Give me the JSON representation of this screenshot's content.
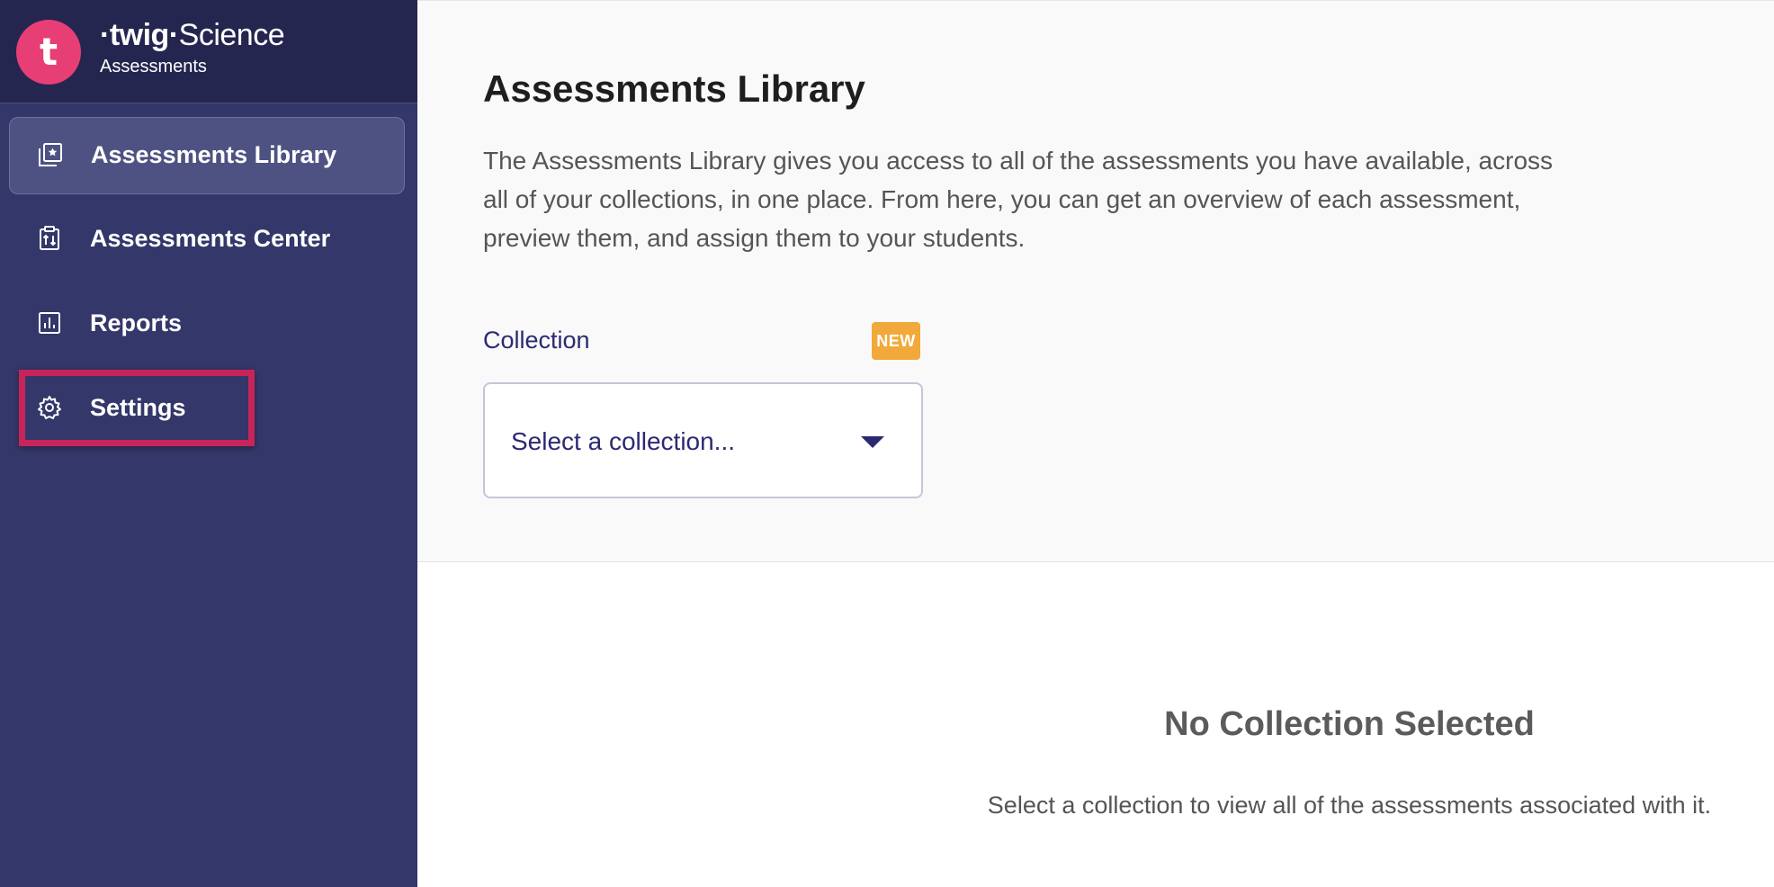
{
  "brand": {
    "logo_letter": "t",
    "wordmark_bold": "·twig·",
    "wordmark_light": "Science",
    "subtitle": "Assessments"
  },
  "sidebar": {
    "items": [
      {
        "label": "Assessments Library",
        "icon": "library-star-icon",
        "active": true
      },
      {
        "label": "Assessments Center",
        "icon": "clipboard-sort-icon",
        "active": false
      },
      {
        "label": "Reports",
        "icon": "bar-chart-icon",
        "active": false
      },
      {
        "label": "Settings",
        "icon": "gear-icon",
        "active": false,
        "highlighted": true
      }
    ]
  },
  "main": {
    "title": "Assessments Library",
    "description": "The Assessments Library gives you access to all of the assessments you have available, across all of your collections, in one place. From here, you can get an overview of each assessment, preview them, and assign them to your students.",
    "collection": {
      "label": "Collection",
      "badge": "NEW",
      "select_placeholder": "Select a collection..."
    },
    "empty_state": {
      "title": "No Collection Selected",
      "description": "Select a collection to view all of the assessments associated with it."
    }
  },
  "colors": {
    "sidebar_bg": "#343769",
    "brand_bg": "#25264f",
    "logo": "#e83e76",
    "highlight": "#c8245a",
    "badge": "#f2a93b",
    "accent_text": "#2a2a72"
  }
}
